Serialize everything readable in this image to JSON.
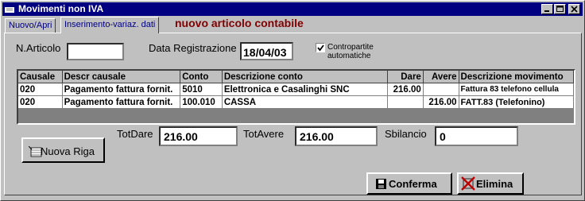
{
  "window": {
    "title": "Movimenti non IVA"
  },
  "tabs": [
    {
      "label": "Nuovo/Apri"
    },
    {
      "label": "Inserimento-variaz. dati"
    }
  ],
  "heading": "nuovo articolo contabile",
  "form": {
    "articolo_label": "N.Articolo",
    "articolo_value": "",
    "data_label": "Data Registrazione",
    "data_value": "18/04/03",
    "contropartite_label_1": "Contropartite",
    "contropartite_label_2": "automatiche",
    "contropartite_checked": true
  },
  "grid": {
    "headers": [
      "Causale",
      "Descr causale",
      "Conto",
      "Descrizione conto",
      "Dare",
      "Avere",
      "Descrizione movimento"
    ],
    "rows": [
      [
        "020",
        "Pagamento fattura fornit.",
        "5010",
        "Elettronica e Casalinghi SNC",
        "216.00",
        "",
        "Fattura 83 telefono cellula"
      ],
      [
        "020",
        "Pagamento fattura fornit.",
        "100.010",
        "CASSA",
        "",
        "216.00",
        "FATT.83 (Telefonino)"
      ]
    ]
  },
  "totals": {
    "dare_label": "TotDare",
    "dare_value": "216.00",
    "avere_label": "TotAvere",
    "avere_value": "216.00",
    "sbilancio_label": "Sbilancio",
    "sbilancio_value": "0"
  },
  "buttons": {
    "nuova_riga": "Nuova Riga",
    "conferma": "Conferma",
    "elimina": "Elimina"
  },
  "icons": {
    "app": "app-window-icon",
    "nuova_riga": "new-row-icon",
    "conferma": "floppy-disk-icon",
    "elimina": "delete-x-icon"
  },
  "colors": {
    "titlebar": "#000080",
    "heading": "#800000",
    "tab_text": "#000080"
  }
}
